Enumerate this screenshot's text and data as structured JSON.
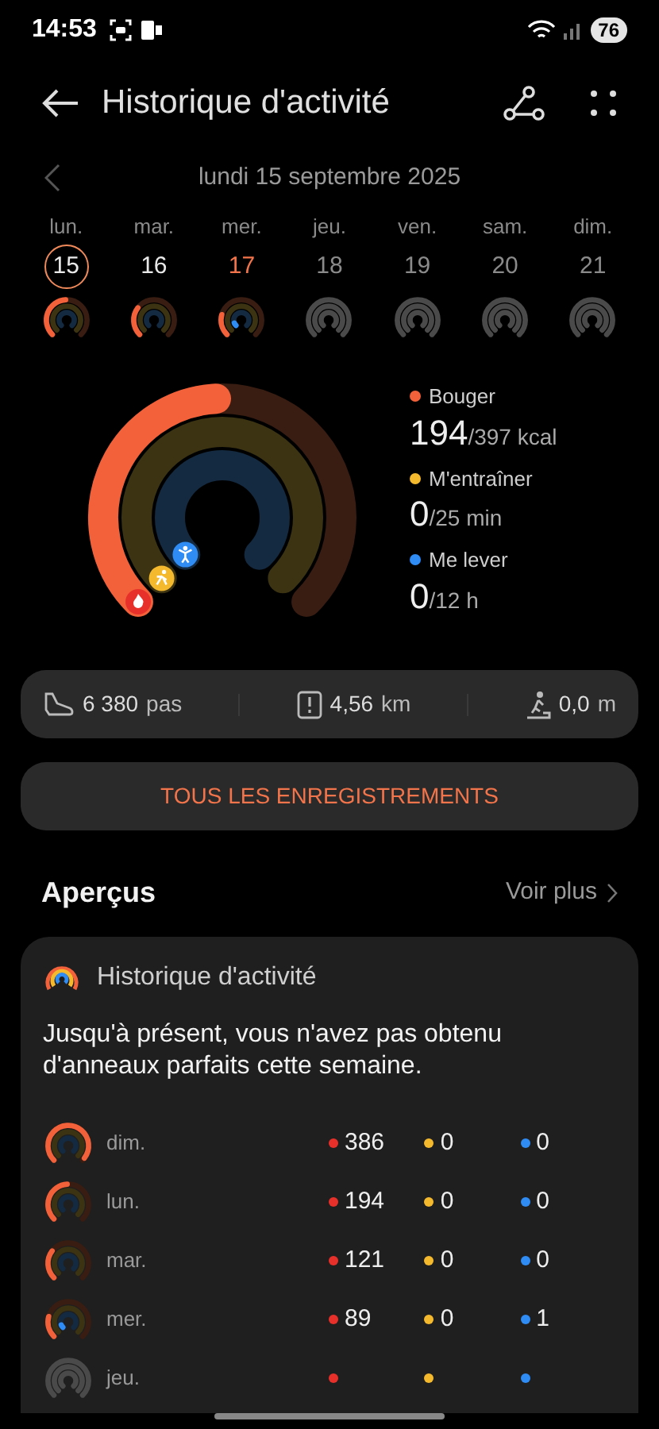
{
  "status_bar": {
    "time": "14:53",
    "battery": "76"
  },
  "header": {
    "title": "Historique d'activité"
  },
  "date_nav": {
    "date": "lundi 15 septembre 2025"
  },
  "days": [
    {
      "weekday": "lun.",
      "day": "15",
      "selected": true,
      "today": false,
      "future": false
    },
    {
      "weekday": "mar.",
      "day": "16",
      "selected": false,
      "today": false,
      "future": false
    },
    {
      "weekday": "mer.",
      "day": "17",
      "selected": false,
      "today": true,
      "future": false
    },
    {
      "weekday": "jeu.",
      "day": "18",
      "selected": false,
      "today": false,
      "future": true
    },
    {
      "weekday": "ven.",
      "day": "19",
      "selected": false,
      "today": false,
      "future": true
    },
    {
      "weekday": "sam.",
      "day": "20",
      "selected": false,
      "today": false,
      "future": true
    },
    {
      "weekday": "dim.",
      "day": "21",
      "selected": false,
      "today": false,
      "future": true
    }
  ],
  "goals": [
    {
      "label": "Bouger",
      "value": "194",
      "target": "/397 kcal",
      "color": "#f2613a"
    },
    {
      "label": "M'entraîner",
      "value": "0",
      "target": "/25 min",
      "color": "#f5b92e"
    },
    {
      "label": "Me lever",
      "value": "0",
      "target": "/12 h",
      "color": "#2f8cf5"
    }
  ],
  "stats": [
    {
      "kind": "steps",
      "value": "6 380",
      "unit": "pas"
    },
    {
      "kind": "distance",
      "value": "4,56",
      "unit": "km"
    },
    {
      "kind": "climb",
      "value": "0,0",
      "unit": "m"
    }
  ],
  "records_button": "TOUS LES ENREGISTREMENTS",
  "insights": {
    "title": "Aperçus",
    "more": "Voir plus",
    "card": {
      "title": "Historique d'activité",
      "message": "Jusqu'à présent, vous n'avez pas obtenu d'anneaux parfaits cette semaine.",
      "rows": [
        {
          "day": "dim.",
          "future": false,
          "values": [
            "386",
            "0",
            "0"
          ]
        },
        {
          "day": "lun.",
          "future": false,
          "values": [
            "194",
            "0",
            "0"
          ]
        },
        {
          "day": "mar.",
          "future": false,
          "values": [
            "121",
            "0",
            "0"
          ]
        },
        {
          "day": "mer.",
          "future": false,
          "values": [
            "89",
            "0",
            "1"
          ]
        },
        {
          "day": "jeu.",
          "future": true
        }
      ]
    }
  }
}
